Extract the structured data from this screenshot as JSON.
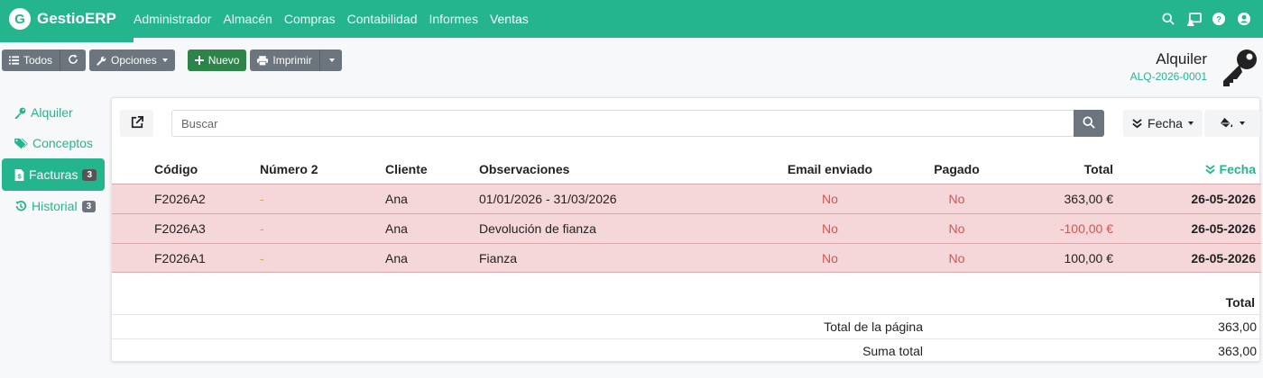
{
  "navbar": {
    "brand_logo": "G",
    "brand": "GestioERP",
    "menu": [
      "Administrador",
      "Almacén",
      "Compras",
      "Contabilidad",
      "Informes",
      "Ventas"
    ],
    "icons": [
      "search-icon",
      "cast-icon",
      "help-icon",
      "user-icon"
    ]
  },
  "toolbar": {
    "all_label": "Todos",
    "options_label": "Opciones",
    "new_label": "Nuevo",
    "print_label": "Imprimir"
  },
  "page": {
    "title": "Alquiler",
    "code": "ALQ-2026-0001"
  },
  "sidebar": {
    "items": [
      {
        "label": "Alquiler",
        "icon": "key-icon"
      },
      {
        "label": "Conceptos",
        "icon": "tags-icon"
      },
      {
        "label": "Facturas",
        "icon": "invoice-icon",
        "badge": "3"
      },
      {
        "label": "Historial",
        "icon": "history-icon",
        "badge": "3"
      }
    ]
  },
  "search": {
    "placeholder": "Buscar",
    "order_label": "Fecha"
  },
  "table": {
    "headers": {
      "code": "Código",
      "num2": "Número 2",
      "client": "Cliente",
      "obs": "Observaciones",
      "email": "Email enviado",
      "paid": "Pagado",
      "total": "Total",
      "date": "Fecha"
    },
    "rows": [
      {
        "code": "F2026A2",
        "num2": "-",
        "client": "Ana",
        "obs": "01/01/2026 - 31/03/2026",
        "email": "No",
        "paid": "No",
        "total": "363,00 €",
        "date": "26-05-2026"
      },
      {
        "code": "F2026A3",
        "num2": "-",
        "client": "Ana",
        "obs": "Devolución de fianza",
        "email": "No",
        "paid": "No",
        "total": "-100,00 €",
        "date": "26-05-2026"
      },
      {
        "code": "F2026A1",
        "num2": "-",
        "client": "Ana",
        "obs": "Fianza",
        "email": "No",
        "paid": "No",
        "total": "100,00 €",
        "date": "26-05-2026"
      }
    ]
  },
  "totals": {
    "header": "Total",
    "page_label": "Total de la página",
    "page_value": "363,00",
    "sum_label": "Suma total",
    "sum_value": "363,00"
  },
  "colors": {
    "accent": "#24b58f",
    "row_bg": "#f5d7da",
    "danger": "#d9534f",
    "new_button": "#2c8448"
  }
}
